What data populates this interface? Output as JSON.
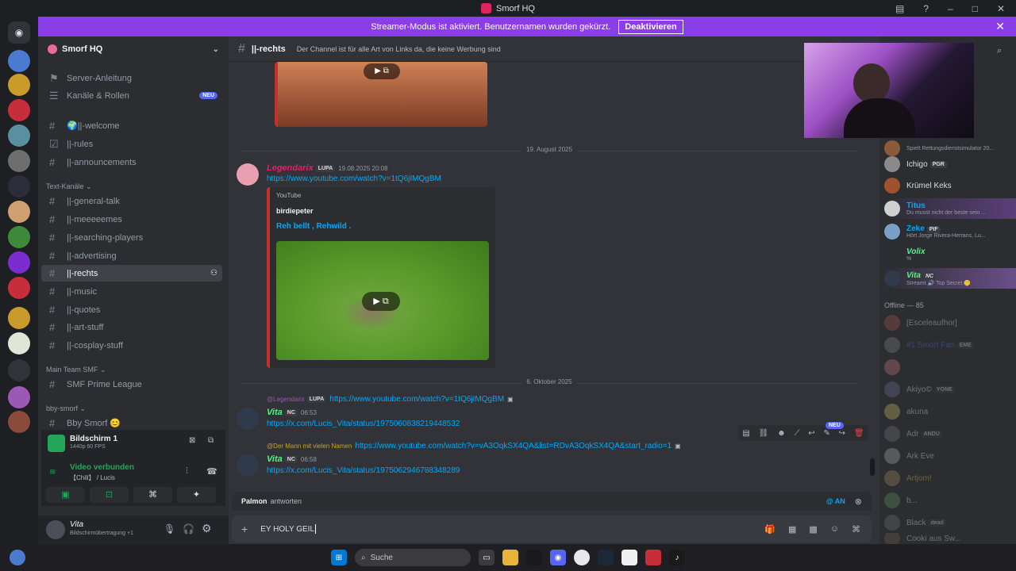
{
  "window": {
    "title": "Smorf HQ"
  },
  "banner": {
    "text": "Streamer-Modus ist aktiviert. Benutzernamen wurden gekürzt.",
    "button": "Deaktivieren"
  },
  "guild": {
    "name": "Smorf HQ"
  },
  "sidebar": {
    "top_items": [
      {
        "label": "Server-Anleitung"
      },
      {
        "label": "Kanäle & Rollen",
        "badge": "NEU"
      }
    ],
    "channels_a": [
      "🌍||-welcome",
      "||-rules",
      "||-announcements"
    ],
    "category_text": "Text-Kanäle",
    "channels_b": [
      "||-general-talk",
      "||-meeeeemes",
      "||-searching-players",
      "||-advertising",
      "||-rechts",
      "||-music",
      "||-quotes",
      "||-art-stuff",
      "||-cosplay-stuff"
    ],
    "category_main": "Main Team SMF",
    "channel_main": "SMF Prime League",
    "category_bby": "bby-smorf",
    "channel_bby": "Bby Smorf 😊"
  },
  "voice": {
    "stream_title": "Bildschirm 1",
    "stream_quality": "1440p 60 FPS",
    "status": "Video verbunden",
    "channel": "【Chill】 / Lucis"
  },
  "user": {
    "name": "Vita",
    "status": "Bildschirmübertragung +1"
  },
  "chat": {
    "channel": "||-rechts",
    "topic": "Der Channel ist für alle Art von Links da, die keine Werbung sind",
    "divider1": "19. August 2025",
    "msg1": {
      "author": "Legendarix",
      "tag": "LUPA",
      "timestamp": "19.08.2025 20:08",
      "link": "https://www.youtube.com/watch?v=1tQ6jIMQgBM",
      "embed_provider": "YouTube",
      "embed_author": "birdiepeter",
      "embed_title": "Reh bellt , Rehwild ."
    },
    "divider2": "6. Oktober 2025",
    "msg2": {
      "reply_user": "@Legendarix",
      "reply_tag": "LUPA",
      "reply_text": "https://www.youtube.com/watch?v=1tQ6jIMQgBM",
      "author": "Vita",
      "tag": "NC",
      "timestamp": "06:53",
      "link": "https://x.com/Lucis_Vita/status/1975060838219448532"
    },
    "msg3": {
      "reply_user": "@Der Mann mit vielen Namen",
      "reply_text": "https://www.youtube.com/watch?v=vA3OqkSX4QA&list=RDvA3OqkSX4QA&start_radio=1",
      "author": "Vita",
      "tag": "NC",
      "timestamp": "06:58",
      "link": "https://x.com/Lucis_Vita/status/1975062946788348289"
    },
    "toolbar_new": "NEU",
    "reply_bar": {
      "prefix": "Palmon",
      "suffix": "antworten",
      "mention": "@ AN"
    },
    "input_value": "EY HOLY GEIL"
  },
  "members": {
    "online": [
      {
        "name": "",
        "sub": "Spielt Rettungsdienstsimulator 20..."
      },
      {
        "name": "Ichigo",
        "tag": "PGR"
      },
      {
        "name": "Krümel Keks"
      },
      {
        "name": "Titus",
        "sub": "Du musst nicht der beste sein ..."
      },
      {
        "name": "Zeke",
        "tag": "PIF",
        "sub": "Hört Jorge Rivera-Herrans, Lu..."
      },
      {
        "name": "Volix",
        "sub": "%"
      },
      {
        "name": "Vita",
        "tag": "NC",
        "sub": "Streamt 🔊 Top Secret 🤫"
      }
    ],
    "offline_header": "Offline — 85",
    "offline": [
      {
        "name": "[Esceleaufhor]"
      },
      {
        "name": "#1 Smorf Fan",
        "tag": "EME"
      },
      {
        "name": ""
      },
      {
        "name": "Akiyo©",
        "tag": "YONE"
      },
      {
        "name": "akuna"
      },
      {
        "name": "Adr",
        "tag": "ANDU"
      },
      {
        "name": "Ark Eve"
      },
      {
        "name": "Artjom!"
      },
      {
        "name": "b..."
      },
      {
        "name": "Black",
        "tag": "dead"
      },
      {
        "name": "Cooki aus Sw..."
      }
    ]
  },
  "taskbar": {
    "search_placeholder": "Suche"
  },
  "colors": {
    "accent": "#5865f2",
    "banner": "#8a3ee8",
    "link": "#00a8fc",
    "yt_red": "#c4302b"
  }
}
